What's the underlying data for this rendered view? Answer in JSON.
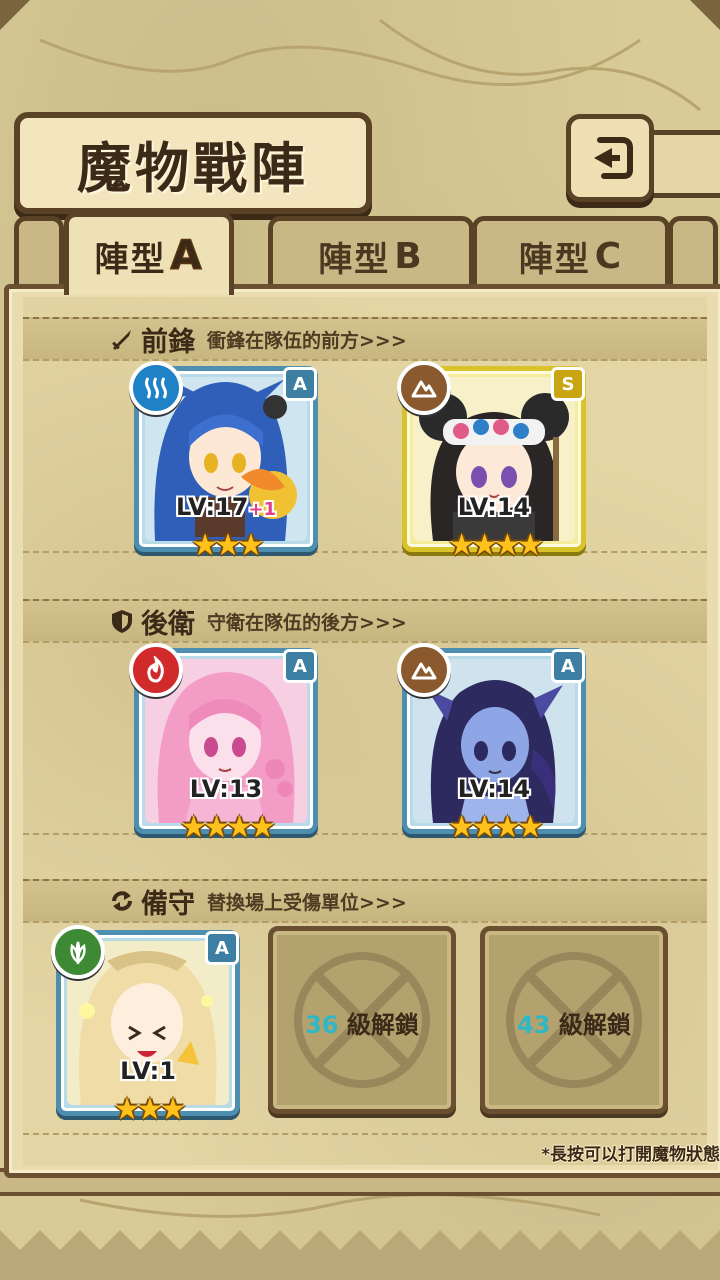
{
  "header": {
    "title": "魔物戰陣",
    "back_icon": "back-arrow-icon"
  },
  "tabs": [
    {
      "label": "陣型",
      "letter": "A",
      "active": true
    },
    {
      "label": "陣型",
      "letter": "B",
      "active": false
    },
    {
      "label": "陣型",
      "letter": "C",
      "active": false
    }
  ],
  "sections": {
    "front": {
      "title": "前鋒",
      "desc": "衝鋒在隊伍的前方>>>",
      "icon": "sword-icon"
    },
    "back": {
      "title": "後衛",
      "desc": "守衛在隊伍的後方>>>",
      "icon": "shield-icon"
    },
    "reserve": {
      "title": "備守",
      "desc": "替換場上受傷單位>>>",
      "icon": "swap-icon"
    }
  },
  "front_cards": [
    {
      "level": "LV:17",
      "bonus": "+1",
      "stars": "★★★",
      "rank": "A",
      "element": "water-icon",
      "element_color": "#1f82c6"
    },
    {
      "level": "LV:14",
      "bonus": "",
      "stars": "★★★★",
      "rank": "S",
      "element": "earth-icon",
      "element_color": "#8a5a2e"
    }
  ],
  "back_cards": [
    {
      "level": "LV:13",
      "bonus": "",
      "stars": "★★★★",
      "rank": "A",
      "element": "fire-icon",
      "element_color": "#d02a2a"
    },
    {
      "level": "LV:14",
      "bonus": "",
      "stars": "★★★★",
      "rank": "A",
      "element": "earth-icon",
      "element_color": "#8a5a2e"
    }
  ],
  "reserve_card": {
    "level": "LV:1",
    "bonus": "",
    "stars": "★★★",
    "rank": "A",
    "element": "wind-icon",
    "element_color": "#3e8a34"
  },
  "locked_slots": [
    {
      "level": "36",
      "suffix": "級解鎖"
    },
    {
      "level": "43",
      "suffix": "級解鎖"
    }
  ],
  "hint": "*長按可以打開魔物狀態"
}
